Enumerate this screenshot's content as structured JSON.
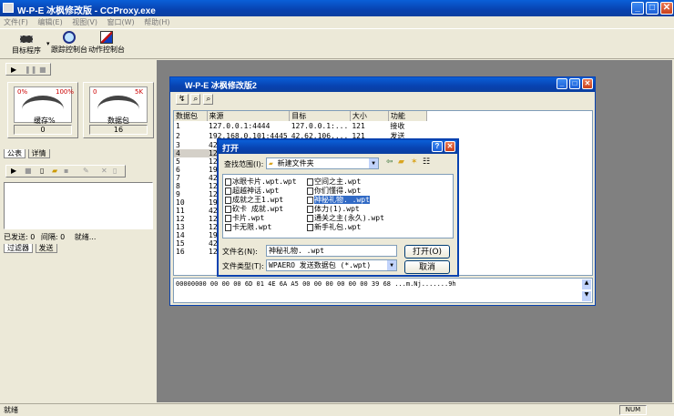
{
  "app": {
    "title": "W-P-E 冰枫修改版 - CCProxy.exe",
    "min": "_",
    "max": "□",
    "close": "✕"
  },
  "menu": [
    "文件(F)",
    "编辑(E)",
    "视图(V)",
    "窗口(W)",
    "帮助(H)"
  ],
  "toolbar": [
    {
      "label": "目标程序",
      "icon": "chip-icon"
    },
    {
      "label": "跟踪控制台",
      "icon": "magnifier-icon"
    },
    {
      "label": "动作控制台",
      "icon": "pencil-icon"
    }
  ],
  "gauges": [
    {
      "name": "缓存%",
      "min": "0%",
      "max": "100%",
      "value": "0"
    },
    {
      "name": "数据包",
      "min": "0",
      "max": "5K",
      "value": "16"
    }
  ],
  "left_tabs_top": [
    "公表",
    "详情"
  ],
  "left_status": {
    "sent": "已发送: 0",
    "interval": "间隔: 0",
    "status": "就绪..."
  },
  "left_tabs_bottom": [
    "过滤器",
    "发送"
  ],
  "child": {
    "title": "W-P-E 冰枫修改版2",
    "columns": [
      "数据包",
      "来源",
      "目标",
      "大小",
      "功能"
    ],
    "rows": [
      [
        "1",
        "127.0.0.1:4444",
        "127.0.0.1:...",
        "121",
        "接收"
      ],
      [
        "2",
        "192.168.0.101:4445",
        "42.62.106....",
        "121",
        "发送"
      ],
      [
        "3",
        "42.",
        "",
        "",
        ""
      ],
      [
        "4",
        "127",
        "",
        "",
        ""
      ],
      [
        "5",
        "127",
        "",
        "",
        ""
      ],
      [
        "6",
        "192",
        "",
        "",
        ""
      ],
      [
        "7",
        "42.",
        "",
        "",
        ""
      ],
      [
        "8",
        "127",
        "",
        "",
        ""
      ],
      [
        "9",
        "127",
        "",
        "",
        ""
      ],
      [
        "10",
        "192",
        "",
        "",
        ""
      ],
      [
        "11",
        "42.",
        "",
        "",
        ""
      ],
      [
        "12",
        "127",
        "",
        "",
        ""
      ],
      [
        "13",
        "127",
        "",
        "",
        ""
      ],
      [
        "14",
        "192",
        "",
        "",
        ""
      ],
      [
        "15",
        "42.",
        "",
        "",
        ""
      ],
      [
        "16",
        "127",
        "",
        "",
        ""
      ]
    ],
    "hex": "00000000  00 00 00 6D 01 4E 6A A5 00 00 00 00 00 00 39 68  ...m.Nj.......9h"
  },
  "dialog": {
    "title": "打开",
    "help": "?",
    "close": "✕",
    "lookin_label": "查找范围(I):",
    "lookin_value": "新建文件夹",
    "files_col1": [
      "冰眼卡片.wpt.wpt",
      "超越神话.wpt",
      "成就之王1.wpt",
      "砍卡 成就.wpt",
      "卡片.wpt",
      "卡无限.wpt"
    ],
    "files_col2": [
      "空间之主.wpt",
      "你们懂得.wpt",
      "神秘礼物. .wpt",
      "体力(1).wpt",
      "通关之主(永久).wpt",
      "新手礼包.wpt"
    ],
    "selected": "神秘礼物. .wpt",
    "filename_label": "文件名(N):",
    "filename_value": "神秘礼物. .wpt",
    "filetype_label": "文件类型(T):",
    "filetype_value": "WPAERO 发送数据包 (*.wpt)",
    "open_button": "打开(O)",
    "cancel_button": "取消"
  },
  "statusbar": {
    "text": "就绪",
    "mode": "NUM"
  }
}
